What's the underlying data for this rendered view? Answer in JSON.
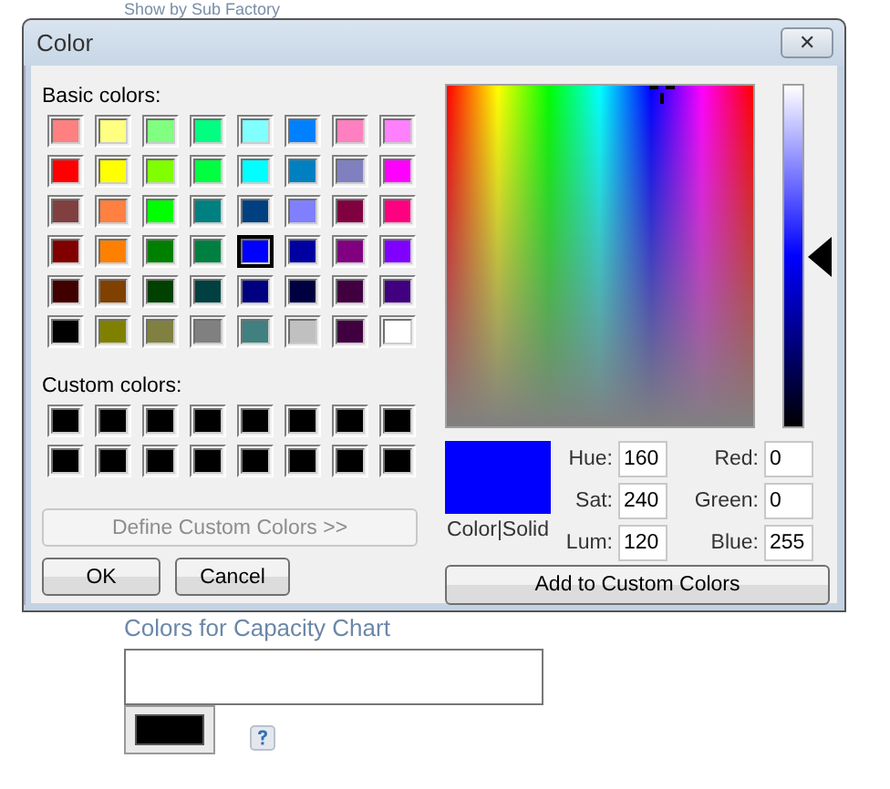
{
  "page": {
    "heading": "Show by Sub Factory",
    "section_label": "Colors for Capacity Chart"
  },
  "dialog": {
    "title": "Color",
    "close_label": "✕",
    "basic_label": "Basic colors:",
    "basic_colors": [
      {
        "color": "#ff8080",
        "selected": false
      },
      {
        "color": "#ffff80",
        "selected": false
      },
      {
        "color": "#80ff80",
        "selected": false
      },
      {
        "color": "#00ff80",
        "selected": false
      },
      {
        "color": "#80ffff",
        "selected": false
      },
      {
        "color": "#0080ff",
        "selected": false
      },
      {
        "color": "#ff80c0",
        "selected": false
      },
      {
        "color": "#ff80ff",
        "selected": false
      },
      {
        "color": "#ff0000",
        "selected": false
      },
      {
        "color": "#ffff00",
        "selected": false
      },
      {
        "color": "#80ff00",
        "selected": false
      },
      {
        "color": "#00ff40",
        "selected": false
      },
      {
        "color": "#00ffff",
        "selected": false
      },
      {
        "color": "#0080c0",
        "selected": false
      },
      {
        "color": "#8080c0",
        "selected": false
      },
      {
        "color": "#ff00ff",
        "selected": false
      },
      {
        "color": "#804040",
        "selected": false
      },
      {
        "color": "#ff8040",
        "selected": false
      },
      {
        "color": "#00ff00",
        "selected": false
      },
      {
        "color": "#008080",
        "selected": false
      },
      {
        "color": "#004080",
        "selected": false
      },
      {
        "color": "#8080ff",
        "selected": false
      },
      {
        "color": "#800040",
        "selected": false
      },
      {
        "color": "#ff0080",
        "selected": false
      },
      {
        "color": "#800000",
        "selected": false
      },
      {
        "color": "#ff8000",
        "selected": false
      },
      {
        "color": "#008000",
        "selected": false
      },
      {
        "color": "#008040",
        "selected": false
      },
      {
        "color": "#0000ff",
        "selected": true
      },
      {
        "color": "#0000a0",
        "selected": false
      },
      {
        "color": "#800080",
        "selected": false
      },
      {
        "color": "#8000ff",
        "selected": false
      },
      {
        "color": "#400000",
        "selected": false
      },
      {
        "color": "#804000",
        "selected": false
      },
      {
        "color": "#004000",
        "selected": false
      },
      {
        "color": "#004040",
        "selected": false
      },
      {
        "color": "#000080",
        "selected": false
      },
      {
        "color": "#000040",
        "selected": false
      },
      {
        "color": "#400040",
        "selected": false
      },
      {
        "color": "#400080",
        "selected": false
      },
      {
        "color": "#000000",
        "selected": false
      },
      {
        "color": "#808000",
        "selected": false
      },
      {
        "color": "#808040",
        "selected": false
      },
      {
        "color": "#808080",
        "selected": false
      },
      {
        "color": "#408080",
        "selected": false
      },
      {
        "color": "#c0c0c0",
        "selected": false
      },
      {
        "color": "#400040",
        "selected": false
      },
      {
        "color": "#ffffff",
        "selected": false
      }
    ],
    "custom_label": "Custom colors:",
    "custom_colors": [
      {
        "color": "#000000"
      },
      {
        "color": "#000000"
      },
      {
        "color": "#000000"
      },
      {
        "color": "#000000"
      },
      {
        "color": "#000000"
      },
      {
        "color": "#000000"
      },
      {
        "color": "#000000"
      },
      {
        "color": "#000000"
      },
      {
        "color": "#000000"
      },
      {
        "color": "#000000"
      },
      {
        "color": "#000000"
      },
      {
        "color": "#000000"
      },
      {
        "color": "#000000"
      },
      {
        "color": "#000000"
      },
      {
        "color": "#000000"
      },
      {
        "color": "#000000"
      }
    ],
    "define_button": {
      "label": "Define Custom Colors >>",
      "disabled": true
    },
    "ok_button": "OK",
    "cancel_button": "Cancel",
    "luminance": {
      "level": 0.5
    },
    "preview_label": "Color|Solid",
    "fields": [
      {
        "label": "Hue:",
        "value": "160"
      },
      {
        "label": "Red:",
        "value": "0"
      },
      {
        "label": "Sat:",
        "value": "240"
      },
      {
        "label": "Green:",
        "value": "0"
      },
      {
        "label": "Lum:",
        "value": "120"
      },
      {
        "label": "Blue:",
        "value": "255"
      }
    ],
    "add_button": "Add to Custom Colors"
  }
}
